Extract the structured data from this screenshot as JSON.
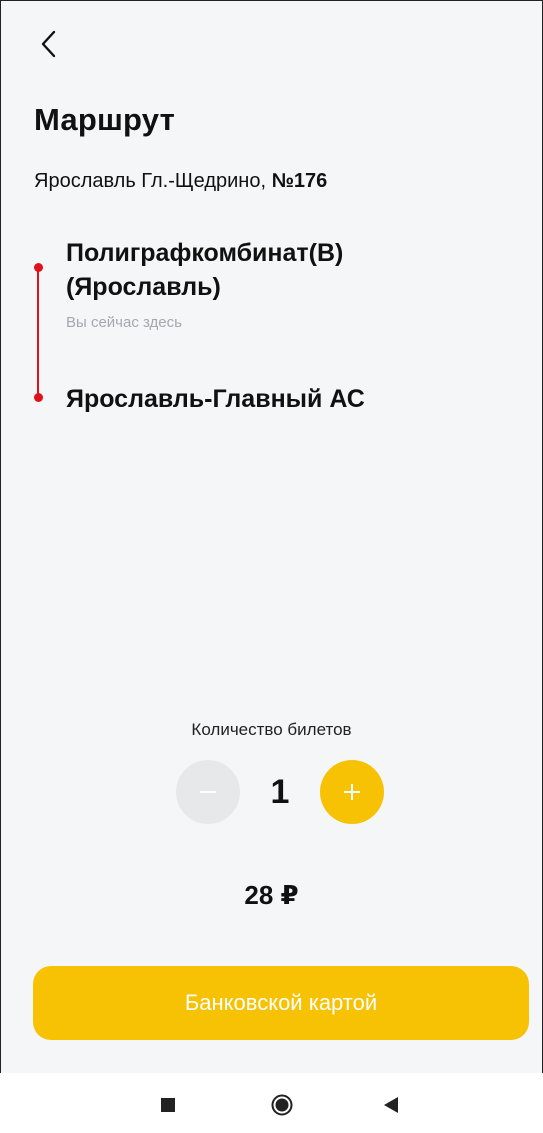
{
  "header": {
    "back_icon": "chevron-left-icon",
    "title": "Маршрут"
  },
  "route": {
    "name": "Ярославль Гл.-Щедрино,",
    "number": "№176"
  },
  "stops": [
    {
      "name": "Полиграфкомбинат(В) (Ярославль)",
      "note": "Вы сейчас здесь"
    },
    {
      "name": "Ярославль-Главный АС",
      "note": ""
    }
  ],
  "tickets": {
    "label": "Количество билетов",
    "count": "1",
    "minus_icon": "minus-icon",
    "plus_icon": "plus-icon"
  },
  "price": "28 ₽",
  "pay_button_label": "Банковской картой",
  "colors": {
    "accent": "#f6c203",
    "route_line": "#e0111b",
    "disabled": "#e6e8ea",
    "muted_text": "#a4a8ad"
  },
  "nav_icons": [
    "recent-apps-icon",
    "home-icon",
    "back-icon"
  ]
}
